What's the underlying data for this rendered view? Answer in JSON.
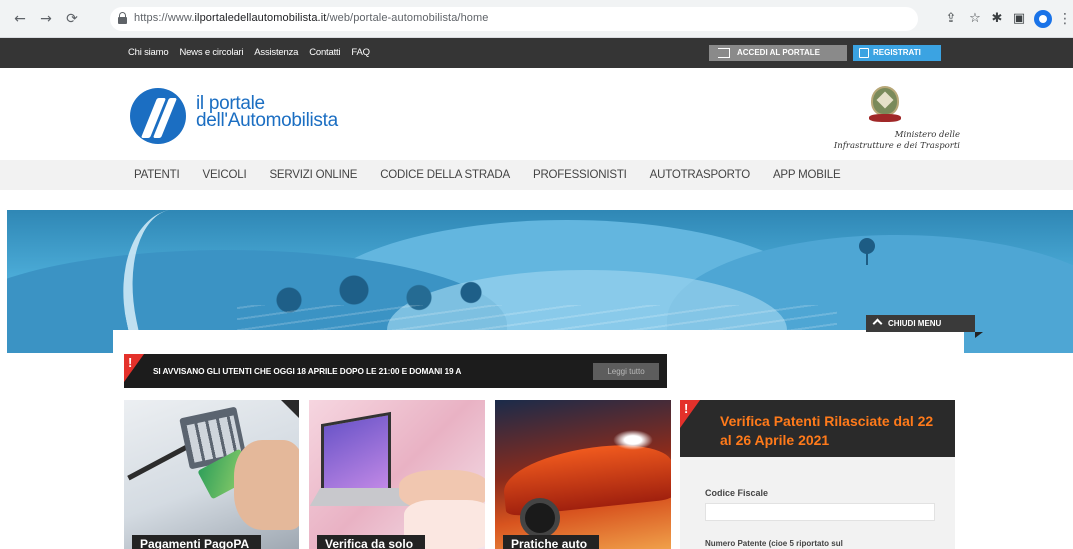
{
  "browser": {
    "url_prefix": "https://www.",
    "url_domain": "ilportaledellautomobilista.it",
    "url_path": "/web/portale-automobilista/home",
    "back_icon": "arrow-left-icon",
    "forward_icon": "arrow-right-icon",
    "reload_icon": "reload-icon",
    "share_icon": "share-icon",
    "bookmark_icon": "star-icon",
    "extensions_icon": "puzzle-icon",
    "sidepanel_icon": "sidepanel-icon",
    "profile_icon": "profile-icon",
    "menu_icon": "kebab-menu-icon"
  },
  "topbar": {
    "links": [
      "Chi siamo",
      "News e circolari",
      "Assistenza",
      "Contatti",
      "FAQ"
    ],
    "login_label": "ACCEDI AL PORTALE",
    "register_label": "REGISTRATI",
    "colors": {
      "bar": "#353535",
      "login": "#8a8a8a",
      "register": "#3ba3e2"
    }
  },
  "header": {
    "logo_line1": "il portale",
    "logo_line2": "dell'Automobilista",
    "ministry_line1": "Ministero delle",
    "ministry_line2": "Infrastrutture e dei Trasporti",
    "brand_color": "#1b6ec2"
  },
  "mainnav": {
    "items": [
      "PATENTI",
      "VEICOLI",
      "SERVIZI ONLINE",
      "CODICE DELLA STRADA",
      "PROFESSIONISTI",
      "AUTOTRASPORTO",
      "APP MOBILE"
    ]
  },
  "hero": {
    "close_menu_label": "CHIUDI MENU"
  },
  "alert": {
    "text": "SI AVVISANO GLI UTENTI CHE OGGI 18 APRILE DOPO LE 21:00 E DOMANI 19 A",
    "read_all_label": "Leggi tutto",
    "accent_color": "#e4312b"
  },
  "cards": [
    {
      "label": "Pagamenti PagoPA"
    },
    {
      "label": "Verifica da solo"
    },
    {
      "label": "Pratiche auto"
    }
  ],
  "side_panel": {
    "title": "Verifica Patenti Rilasciate dal 22 al 26 Aprile 2021",
    "cf_label": "Codice Fiscale",
    "cf_value": "",
    "np_label": "Numero Patente (cioe 5 riportato sul",
    "title_color": "#ff7a1a"
  }
}
